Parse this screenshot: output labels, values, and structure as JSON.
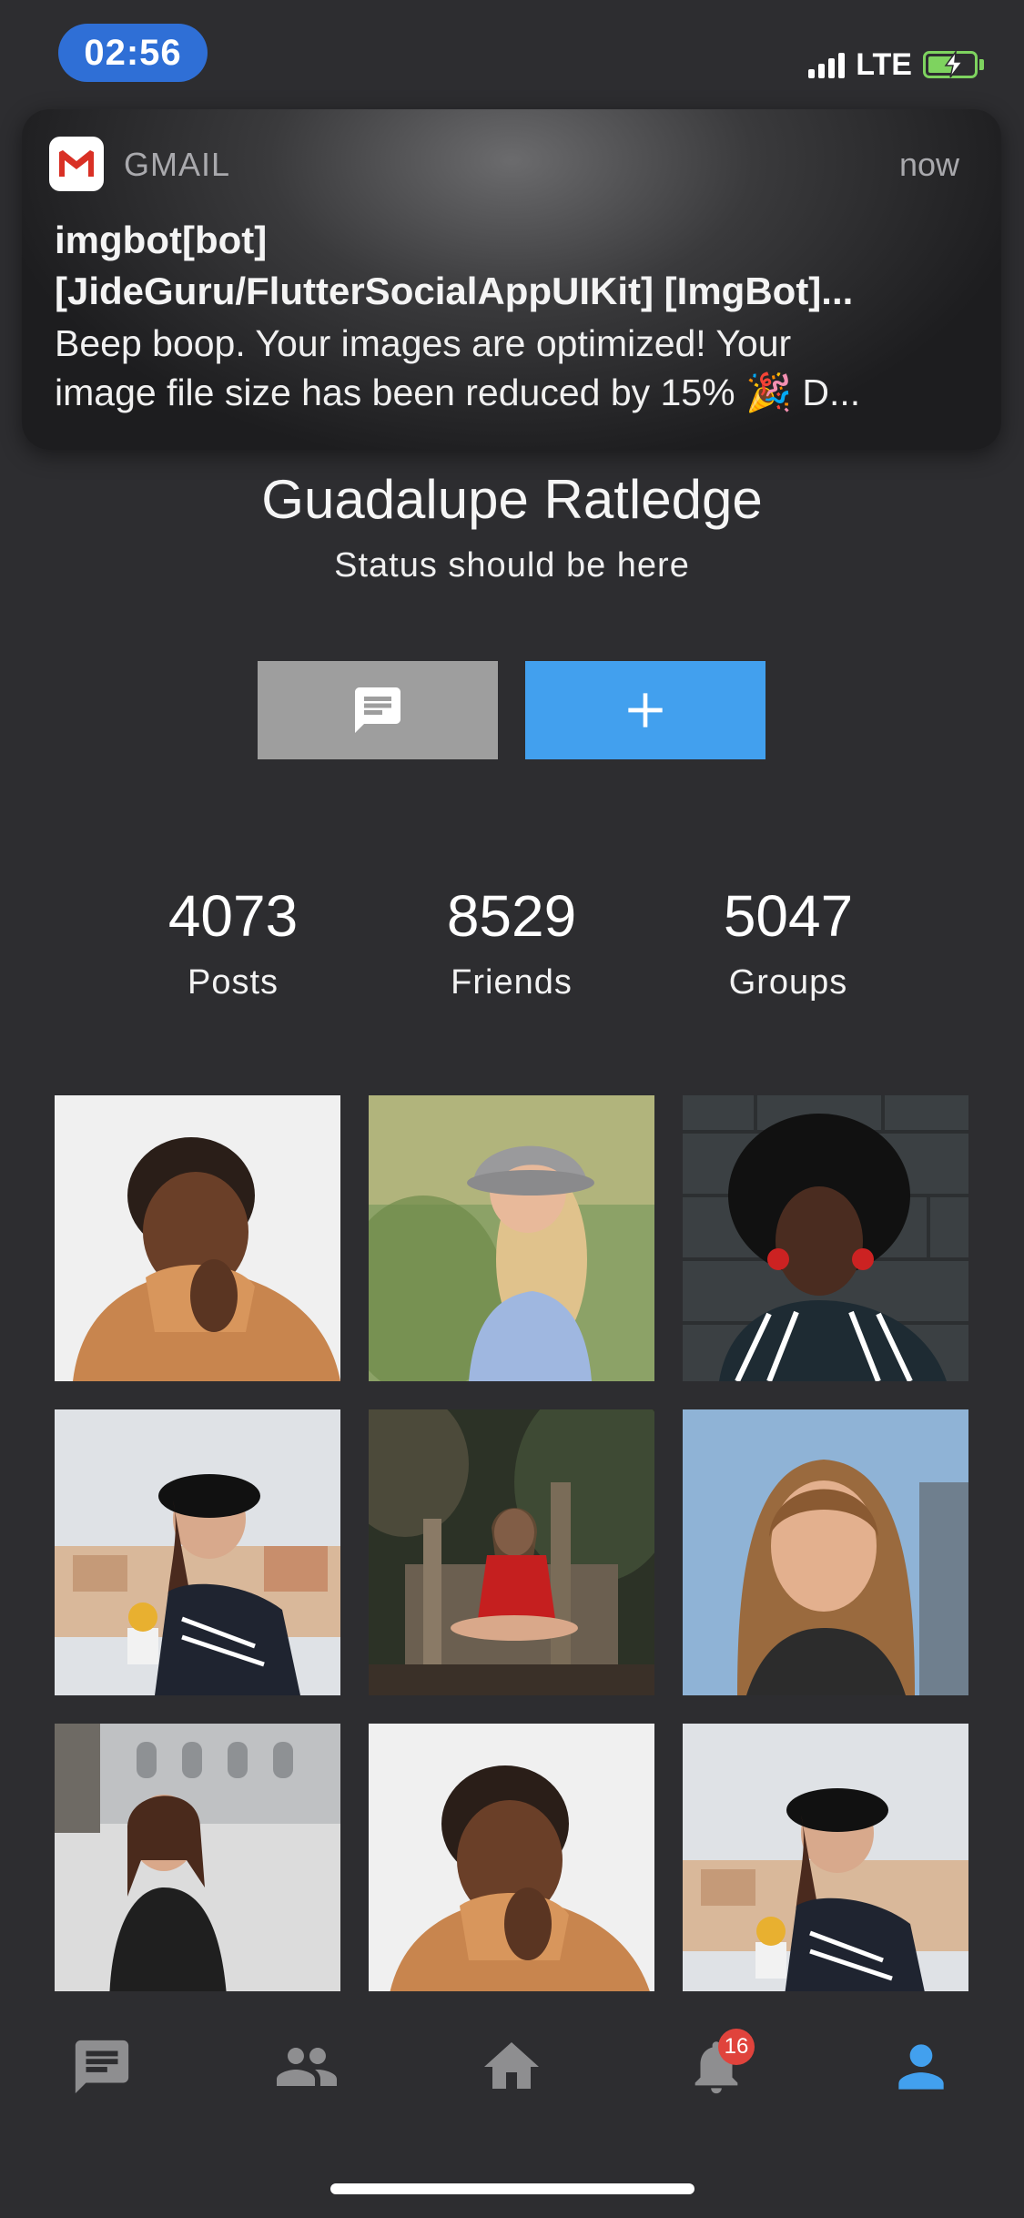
{
  "status_bar": {
    "time": "02:56",
    "network": "LTE"
  },
  "notification": {
    "app": "GMAIL",
    "time": "now",
    "title_line1": "imgbot[bot]",
    "title_line2": "[JideGuru/FlutterSocialAppUIKit] [ImgBot]...",
    "body_line1": "Beep boop. Your images are optimized! Your",
    "body_line2": "image file size has been reduced by 15% 🎉 D..."
  },
  "profile": {
    "name": "Guadalupe Ratledge",
    "status": "Status should be here"
  },
  "actions": {
    "message_icon": "message-icon",
    "add_icon": "add-icon"
  },
  "stats": [
    {
      "value": "4073",
      "label": "Posts"
    },
    {
      "value": "8529",
      "label": "Friends"
    },
    {
      "value": "5047",
      "label": "Groups"
    }
  ],
  "photos": [
    {
      "name": "photo-1"
    },
    {
      "name": "photo-2"
    },
    {
      "name": "photo-3"
    },
    {
      "name": "photo-4"
    },
    {
      "name": "photo-5"
    },
    {
      "name": "photo-6"
    },
    {
      "name": "photo-7"
    },
    {
      "name": "photo-8"
    },
    {
      "name": "photo-9"
    }
  ],
  "nav": {
    "items": [
      "chat-icon",
      "friends-icon",
      "home-icon",
      "notifications-icon",
      "profile-icon"
    ],
    "notification_count": "16",
    "active": "profile-icon",
    "active_color": "#42a0ee",
    "inactive_color": "#8e8e90"
  },
  "colors": {
    "background": "#2d2d30",
    "accent": "#42a0ee",
    "time_pill": "#2f6fd6",
    "badge": "#e0433c"
  }
}
